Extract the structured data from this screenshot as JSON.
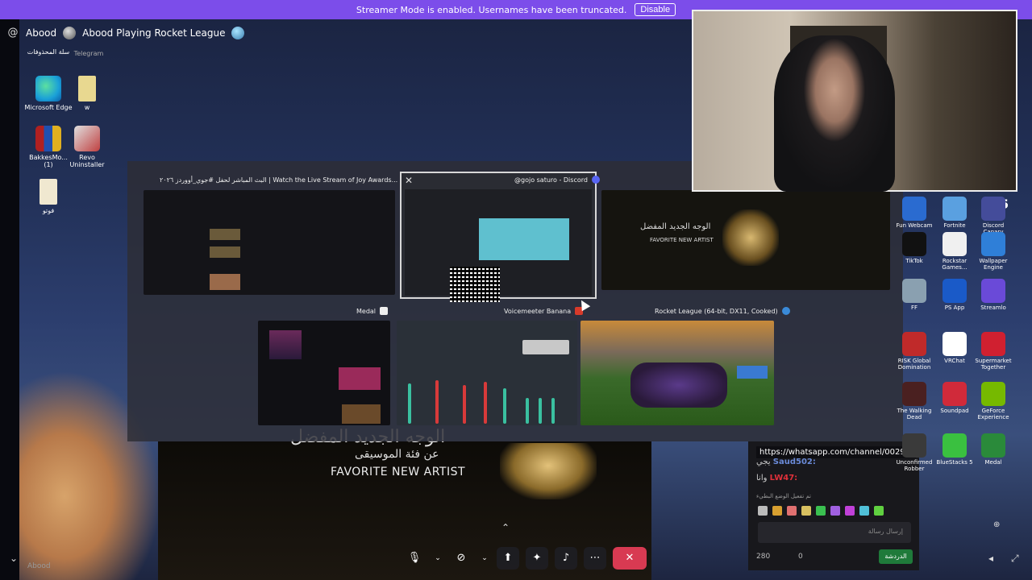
{
  "banner": {
    "text": "Streamer Mode is enabled. Usernames have been truncated.",
    "disable_label": "Disable"
  },
  "header": {
    "user": "Abood",
    "activity": "Abood Playing Rocket League"
  },
  "desktop_left": [
    {
      "label": "سلة المحذوفات",
      "color": "#6b7a8a"
    },
    {
      "label": "Telegram",
      "color": "#2ea6e0"
    },
    {
      "label": "Microsoft Edge",
      "color": "#1aa0d8"
    },
    {
      "label": "w",
      "color": "#d8c060"
    },
    {
      "label": "BakkesMo... (1)",
      "color": "#b02020"
    },
    {
      "label": "Revo Uninstaller",
      "color": "#c04040"
    },
    {
      "label": "فوتو",
      "color": "#e8e0c8"
    }
  ],
  "switcher": {
    "windows": [
      {
        "title": "البث المباشر لحفل #جوي_أووردز ٢٠٢٦ | Watch the Live Stream of Joy Awards...",
        "app": "chrome-icon"
      },
      {
        "title": "@gojo saturo - Discord",
        "app": "discord-icon"
      },
      {
        "title": "Medal",
        "app": "medal-icon"
      },
      {
        "title": "Voicemeeter Banana",
        "app": "voicemeeter-icon"
      },
      {
        "title": "Rocket League (64-bit, DX11, Cooked)",
        "app": "rocket-league-icon"
      }
    ]
  },
  "stage": {
    "arabic_title": "الوجه الجديد المفضل",
    "arabic_sub": "عن فئة الموسيقى",
    "english": "FAVORITE NEW ARTIST"
  },
  "chat": {
    "link": "https://whatsapp.com/channel/0029...",
    "line1_user": "Saud502:",
    "line1_msg": "يجي",
    "line2_user": "LW47:",
    "line2_msg": "وانا",
    "status": "تم تفعيل الوضع البطيء",
    "input_placeholder": "إرسال رسالة",
    "count": "280",
    "zero": "0",
    "send_label": "الدردشة"
  },
  "desktop_right": [
    {
      "label": "Fun Webcam",
      "color": "#2a6bd0"
    },
    {
      "label": "Fortnite",
      "color": "#5aa0e0"
    },
    {
      "label": "Discord Canary",
      "color": "#444c9a"
    },
    {
      "label": "TikTok",
      "color": "#111111"
    },
    {
      "label": "Rockstar Games...",
      "color": "#f0f0f0"
    },
    {
      "label": "Wallpaper Engine",
      "color": "#2f7fd8"
    },
    {
      "label": "FF",
      "color": "#8aa0b0"
    },
    {
      "label": "PS App",
      "color": "#1a5ac8"
    },
    {
      "label": "Streamlo",
      "color": "#6a4ad8"
    },
    {
      "label": "RISK Global Domination",
      "color": "#c02a2a"
    },
    {
      "label": "VRChat",
      "color": "#ffffff"
    },
    {
      "label": "Supermarket Together",
      "color": "#d02030"
    },
    {
      "label": "The Walking Dead",
      "color": "#4a2020"
    },
    {
      "label": "Soundpad",
      "color": "#d02a3a"
    },
    {
      "label": "GeForce Experience",
      "color": "#76b900"
    },
    {
      "label": "Unconfirmed Robber",
      "color": "#3a3a3a"
    },
    {
      "label": "BlueStacks 5",
      "color": "#3ac040"
    },
    {
      "label": "Medal",
      "color": "#2a8a3a"
    }
  ],
  "counter_badge": "5",
  "bottom_label": "Abood",
  "controls": [
    {
      "name": "microphone-button",
      "glyph": "🎙"
    },
    {
      "name": "camera-off-button",
      "glyph": "⛔"
    },
    {
      "name": "screen-share-button",
      "glyph": "⤴"
    },
    {
      "name": "activities-button",
      "glyph": "✦"
    },
    {
      "name": "soundboard-button",
      "glyph": "♪"
    },
    {
      "name": "more-options-button",
      "glyph": "⋯"
    },
    {
      "name": "end-stream-button",
      "glyph": "✕"
    }
  ]
}
